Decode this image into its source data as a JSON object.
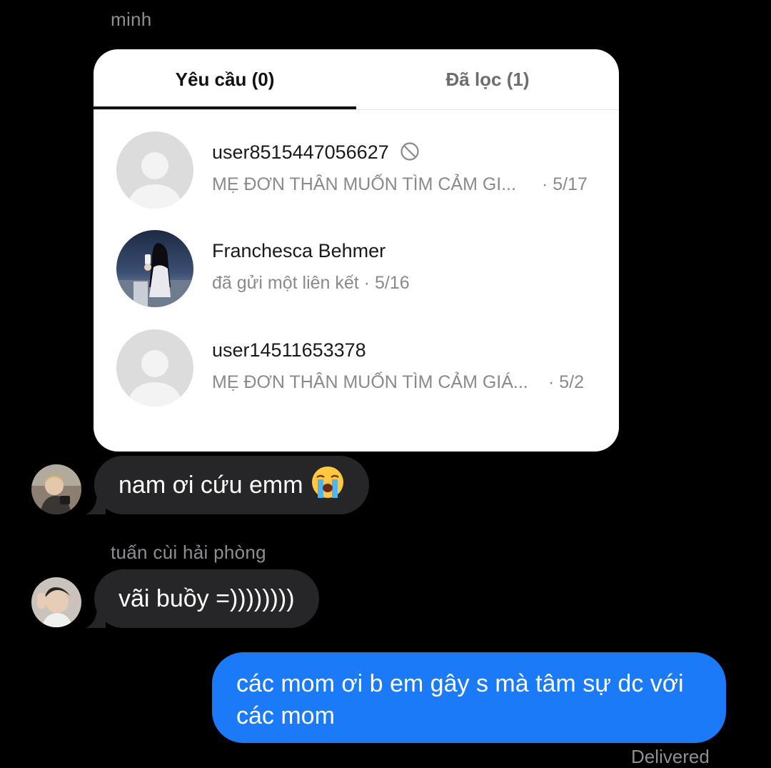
{
  "chat": {
    "senders": {
      "minh": "minh",
      "tuan": "tuấn cùi hải phòng"
    },
    "card": {
      "tabs": {
        "active": "Yêu cầu (0)",
        "inactive": "Đã lọc (1)"
      },
      "requests": [
        {
          "name": "user8515447056627",
          "preview": "MẸ ĐƠN THÂN MUỐN TÌM CẢM GI...",
          "date": "· 5/17",
          "avatar": "default-avatar",
          "restricted_icon": "block-icon"
        },
        {
          "name": "Franchesca Behmer",
          "preview": "đã gửi một liên kết · 5/16",
          "date": "",
          "avatar": "photo-avatar"
        },
        {
          "name": "user14511653378",
          "preview": "MẸ ĐƠN THÂN MUỐN TÌM CẢM GIÁ...",
          "date": "· 5/2",
          "avatar": "default-avatar"
        }
      ]
    },
    "messages": [
      {
        "direction": "in",
        "text": "nam ơi cứu emm",
        "emoji": "loudly-crying-face"
      },
      {
        "direction": "in",
        "text": "vãi buồy =))))))))"
      },
      {
        "direction": "out",
        "text": "các mom ơi b em gây s mà tâm sự dc với các mom"
      }
    ],
    "status": "Delivered"
  },
  "colors": {
    "background": "#000000",
    "incoming_bubble": "#262628",
    "outgoing_bubble": "#1a7af8",
    "meta_text": "#8e8e93"
  }
}
